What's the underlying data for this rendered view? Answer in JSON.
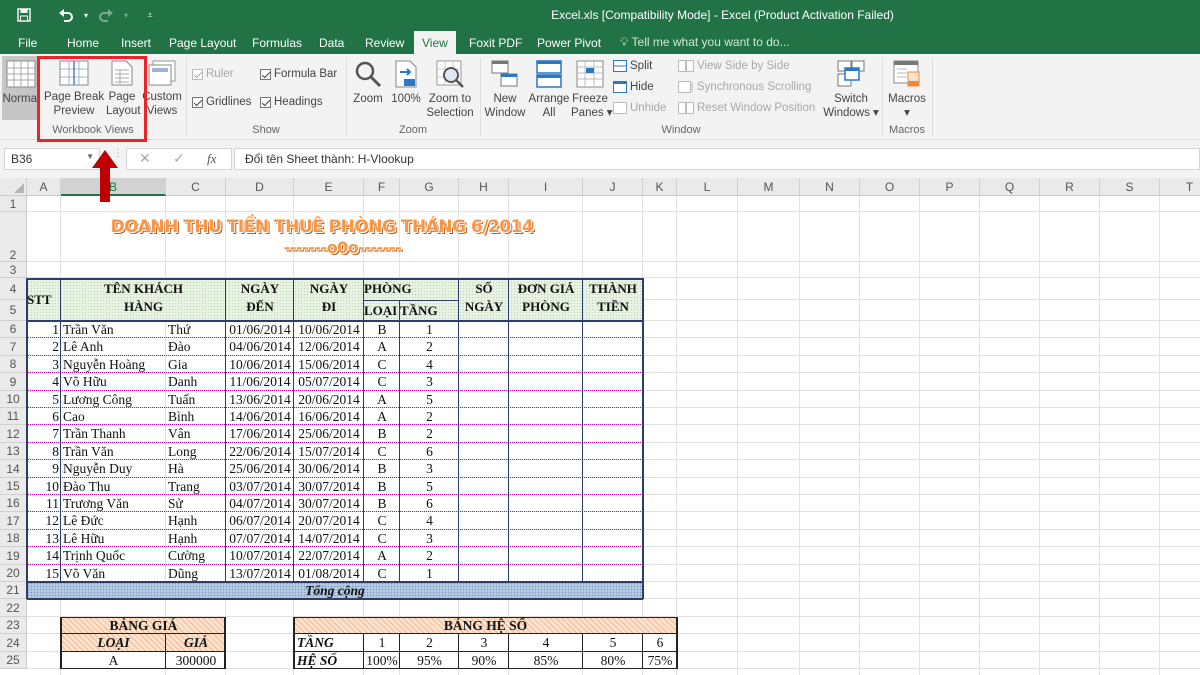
{
  "window": {
    "title": "Excel.xls  [Compatibility Mode] - Excel (Product Activation Failed)"
  },
  "qat": {
    "save_icon": "save-icon",
    "undo_icon": "undo-icon",
    "redo_icon": "redo-icon",
    "customize_icon": "customize-qat-icon"
  },
  "tabs": [
    {
      "label": "File"
    },
    {
      "label": "Home"
    },
    {
      "label": "Insert"
    },
    {
      "label": "Page Layout"
    },
    {
      "label": "Formulas"
    },
    {
      "label": "Data"
    },
    {
      "label": "Review"
    },
    {
      "label": "View",
      "active": true
    },
    {
      "label": "Foxit PDF"
    },
    {
      "label": "Power Pivot"
    }
  ],
  "tellme": "Tell me what you want to do...",
  "ribbon": {
    "workbook_views": {
      "label": "Workbook Views",
      "normal": "Normal",
      "page_break_1": "Page Break",
      "page_break_2": "Preview",
      "page_layout_1": "Page",
      "page_layout_2": "Layout",
      "custom_1": "Custom",
      "custom_2": "Views"
    },
    "show": {
      "label": "Show",
      "ruler": {
        "label": "Ruler",
        "checked": true,
        "disabled": true
      },
      "formula_bar": {
        "label": "Formula Bar",
        "checked": true
      },
      "gridlines": {
        "label": "Gridlines",
        "checked": true
      },
      "headings": {
        "label": "Headings",
        "checked": true
      }
    },
    "zoom": {
      "label": "Zoom",
      "zoom": "Zoom",
      "hundred": "100%",
      "sel_1": "Zoom to",
      "sel_2": "Selection"
    },
    "window": {
      "label": "Window",
      "new_1": "New",
      "new_2": "Window",
      "arrange_1": "Arrange",
      "arrange_2": "All",
      "freeze_1": "Freeze",
      "freeze_2": "Panes ▾",
      "split": "Split",
      "hide": "Hide",
      "unhide": "Unhide",
      "side_by_side": "View Side by Side",
      "sync_scroll": "Synchronous Scrolling",
      "reset_pos": "Reset Window Position",
      "switch_1": "Switch",
      "switch_2": "Windows ▾"
    },
    "macros": {
      "label": "Macros",
      "btn": "Macros",
      "arrow": "▾"
    }
  },
  "formula_bar": {
    "name_box": "B36",
    "cancel": "✕",
    "enter": "✓",
    "fx": "fx",
    "content": "Đổi tên Sheet thành: H-Vlookup"
  },
  "columns": [
    "A",
    "B",
    "C",
    "D",
    "E",
    "F",
    "G",
    "H",
    "I",
    "J",
    "K",
    "L",
    "M",
    "N",
    "O",
    "P",
    "Q",
    "R",
    "S",
    "T"
  ],
  "selected_column": "B",
  "rows": [
    "1",
    "2",
    "3",
    "4",
    "5",
    "6",
    "7",
    "8",
    "9",
    "10",
    "11",
    "12",
    "13",
    "14",
    "15",
    "16",
    "17",
    "18",
    "19",
    "20",
    "21",
    "22",
    "23",
    "24",
    "25"
  ],
  "sheet": {
    "title": "DOANH THU TIỀN THUÊ PHÒNG THÁNG 6/2014",
    "subtitle": "-------o0o-------",
    "headers": {
      "stt": "STT",
      "ten_1": "TÊN  KHÁCH",
      "ten_2": "HÀNG",
      "den_1": "NGÀY",
      "den_2": "ĐẾN",
      "di_1": "NGÀY",
      "di_2": "ĐI",
      "phong": "PHÒNG",
      "loai": "LOẠI",
      "tang": "TẦNG",
      "songay_1": "SỐ",
      "songay_2": "NGÀY",
      "dongia_1": "ĐƠN GIÁ",
      "dongia_2": "PHÒNG",
      "thanhtien_1": "THÀNH",
      "thanhtien_2": "TIỀN"
    },
    "records": [
      {
        "stt": "1",
        "ho": "Trần Văn",
        "ten": "Thứ",
        "den": "01/06/2014",
        "di": "10/06/2014",
        "loai": "B",
        "tang": "1"
      },
      {
        "stt": "2",
        "ho": "Lê Anh",
        "ten": "Đào",
        "den": "04/06/2014",
        "di": "12/06/2014",
        "loai": "A",
        "tang": "2"
      },
      {
        "stt": "3",
        "ho": "Nguyễn Hoàng",
        "ten": "Gia",
        "den": "10/06/2014",
        "di": "15/06/2014",
        "loai": "C",
        "tang": "4"
      },
      {
        "stt": "4",
        "ho": "Võ Hữu",
        "ten": "Danh",
        "den": "11/06/2014",
        "di": "05/07/2014",
        "loai": "C",
        "tang": "3"
      },
      {
        "stt": "5",
        "ho": "Lương Công",
        "ten": "Tuấn",
        "den": "13/06/2014",
        "di": "20/06/2014",
        "loai": "A",
        "tang": "5"
      },
      {
        "stt": "6",
        "ho": "Cao",
        "ten": "Bình",
        "den": "14/06/2014",
        "di": "16/06/2014",
        "loai": "A",
        "tang": "2"
      },
      {
        "stt": "7",
        "ho": "Trần Thanh",
        "ten": "Vân",
        "den": "17/06/2014",
        "di": "25/06/2014",
        "loai": "B",
        "tang": "2"
      },
      {
        "stt": "8",
        "ho": "Trần Văn",
        "ten": "Long",
        "den": "22/06/2014",
        "di": "15/07/2014",
        "loai": "C",
        "tang": "6"
      },
      {
        "stt": "9",
        "ho": "Nguyễn Duy",
        "ten": "Hà",
        "den": "25/06/2014",
        "di": "30/06/2014",
        "loai": "B",
        "tang": "3"
      },
      {
        "stt": "10",
        "ho": "Đào Thu",
        "ten": "Trang",
        "den": "03/07/2014",
        "di": "30/07/2014",
        "loai": "B",
        "tang": "5"
      },
      {
        "stt": "11",
        "ho": "Trương Văn",
        "ten": "Sử",
        "den": "04/07/2014",
        "di": "30/07/2014",
        "loai": "B",
        "tang": "6"
      },
      {
        "stt": "12",
        "ho": "Lê Đức",
        "ten": "Hạnh",
        "den": "06/07/2014",
        "di": "20/07/2014",
        "loai": "C",
        "tang": "4"
      },
      {
        "stt": "13",
        "ho": "Lê Hữu",
        "ten": "Hạnh",
        "den": "07/07/2014",
        "di": "14/07/2014",
        "loai": "C",
        "tang": "3"
      },
      {
        "stt": "14",
        "ho": "Trịnh Quốc",
        "ten": "Cường",
        "den": "10/07/2014",
        "di": "22/07/2014",
        "loai": "A",
        "tang": "2"
      },
      {
        "stt": "15",
        "ho": "Võ Văn",
        "ten": "Dũng",
        "den": "13/07/2014",
        "di": "01/08/2014",
        "loai": "C",
        "tang": "1"
      }
    ],
    "total_label": "Tổng cộng",
    "bang_gia": {
      "title": "BẢNG GIÁ",
      "col_loai": "LOẠI",
      "col_gia": "GIÁ",
      "rows": [
        {
          "loai": "A",
          "gia": "300000"
        }
      ]
    },
    "bang_he_so": {
      "title": "BẢNG HỆ SỐ",
      "row1_label": "TẦNG",
      "row2_label": "HỆ SỐ",
      "tang": [
        "1",
        "2",
        "3",
        "4",
        "5",
        "6"
      ],
      "he_so": [
        "100%",
        "95%",
        "90%",
        "85%",
        "80%",
        "75%"
      ]
    }
  },
  "annotations": {
    "highlight_color": "#e8262a",
    "arrow_color": "#c00000"
  },
  "colors": {
    "excel_green": "#217346",
    "title_orange": "#f79646",
    "header_green": "#e8f3e4",
    "total_blue": "#b8cce4",
    "hatch_orange": "#fbe3cf"
  }
}
